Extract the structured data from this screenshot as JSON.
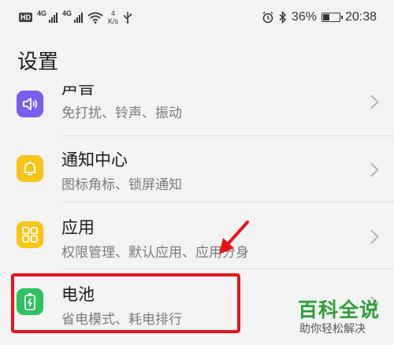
{
  "status_bar": {
    "hd": "HD",
    "net1": "4G",
    "net2": "4G",
    "speed_value": "4",
    "speed_unit": "K/s",
    "battery_text": "36%",
    "battery_level": 0.36,
    "time": "20:38"
  },
  "page": {
    "title": "设置"
  },
  "items": [
    {
      "title": "声音",
      "subtitle": "免打扰、铃声、振动",
      "icon": "speaker-icon",
      "color": "#7b5cf0"
    },
    {
      "title": "通知中心",
      "subtitle": "图标角标、锁屏通知",
      "icon": "bell-icon",
      "color": "#f7c418"
    },
    {
      "title": "应用",
      "subtitle": "权限管理、默认应用、应用分身",
      "icon": "grid-icon",
      "color": "#f7c418"
    },
    {
      "title": "电池",
      "subtitle": "省电模式、耗电排行",
      "icon": "battery-icon",
      "color": "#2dc35f"
    }
  ],
  "annotation": {
    "box_color": "#e8141b",
    "arrow_color": "#e8141b"
  },
  "watermark": {
    "title": "百科全说",
    "subtitle": "助你轻松解决",
    "color": "#2e9e36"
  }
}
